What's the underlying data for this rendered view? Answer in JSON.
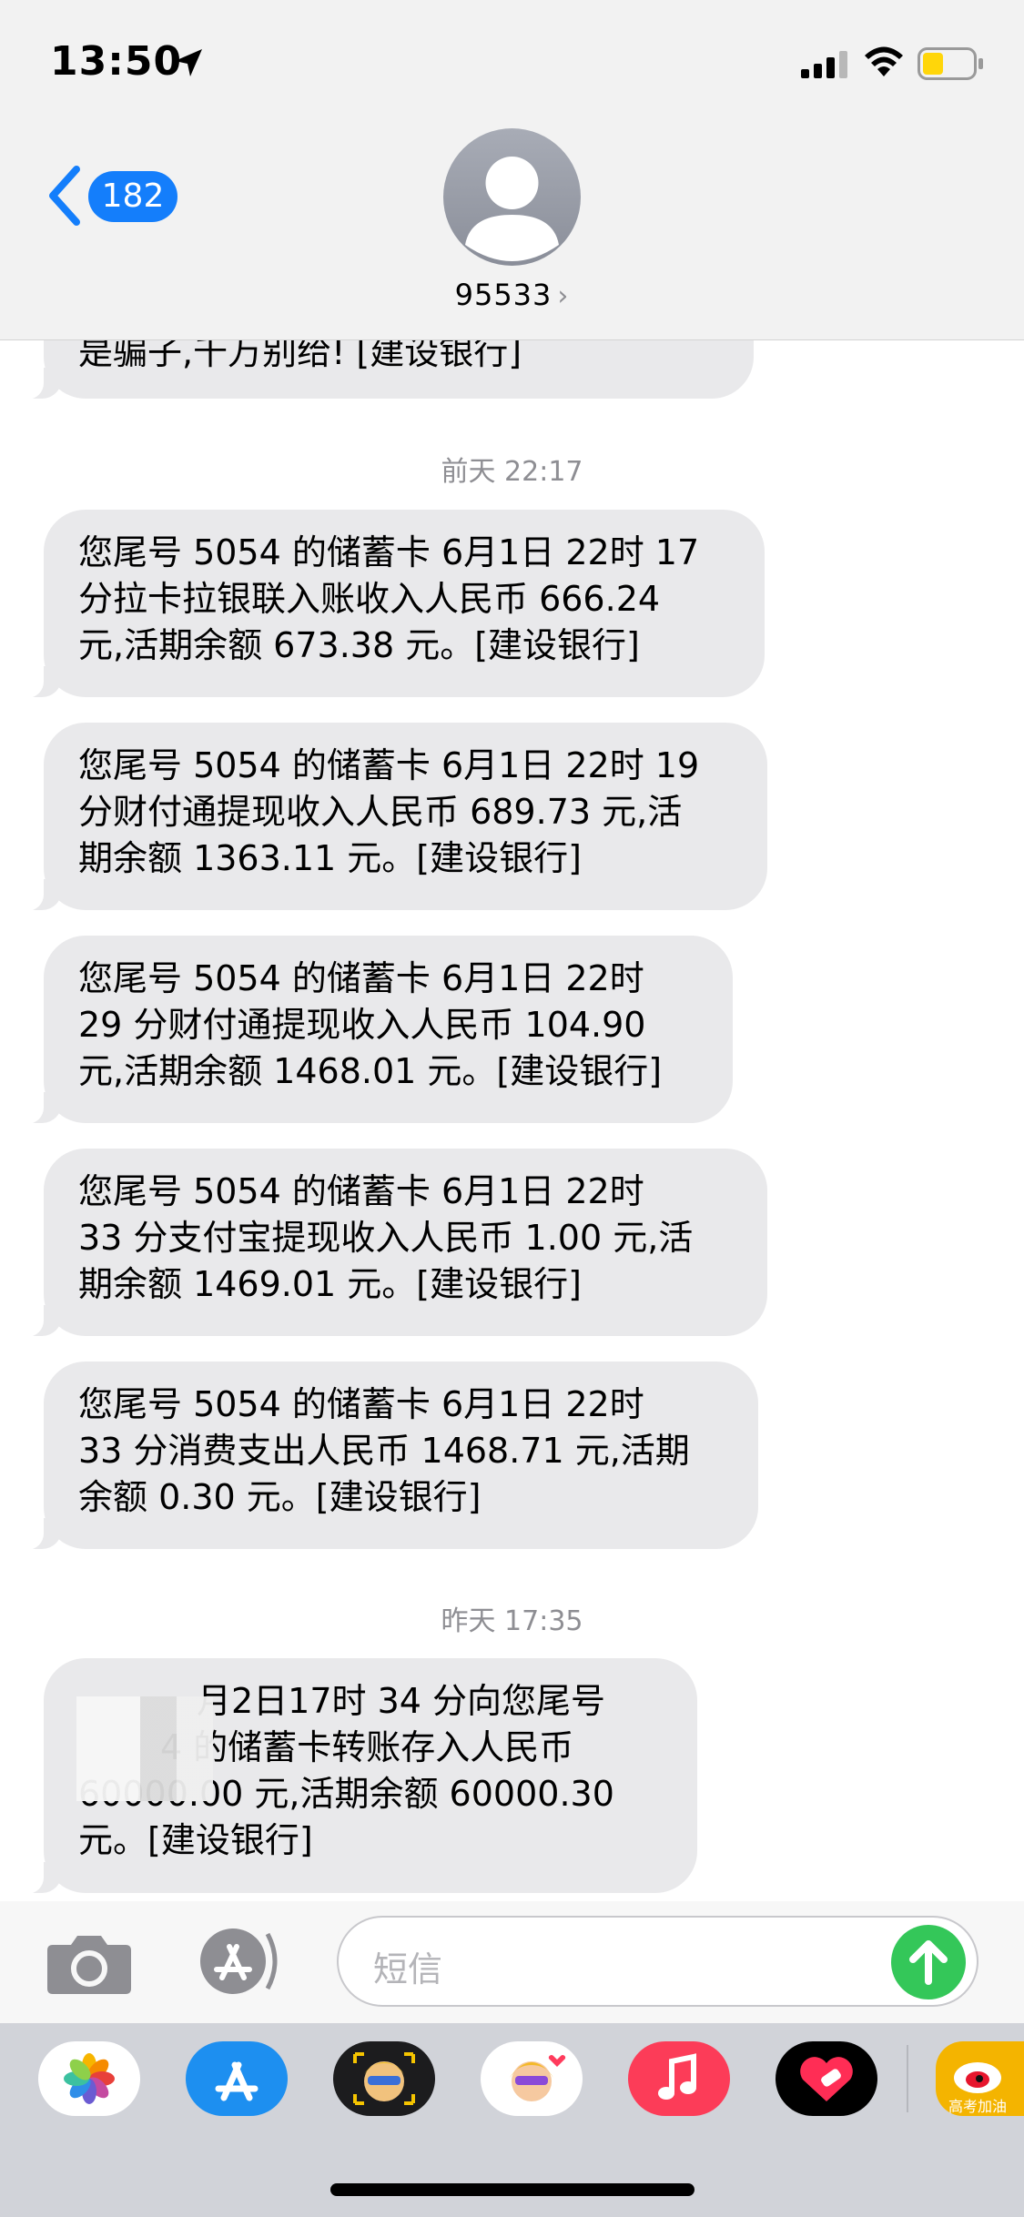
{
  "status": {
    "time": "13:50"
  },
  "nav": {
    "back_count": "182",
    "contact": "95533",
    "chevron": "›"
  },
  "partial_message": "是骗子,千万别给! [建设银行]",
  "timestamps": [
    "前天 22:17",
    "昨天 17:35"
  ],
  "messages": [
    [
      "您尾号 5054 的储蓄卡 6月1日 22时 17",
      "分拉卡拉银联入账收入人民币 666.24",
      "元,活期余额 673.38 元。[建设银行]"
    ],
    [
      "您尾号 5054 的储蓄卡 6月1日 22时 19",
      "分财付通提现收入人民币 689.73 元,活",
      "期余额 1363.11 元。[建设银行]"
    ],
    [
      "您尾号 5054 的储蓄卡 6月1日 22时",
      "29 分财付通提现收入人民币 104.90",
      "元,活期余额 1468.01 元。[建设银行]"
    ],
    [
      "您尾号 5054 的储蓄卡 6月1日 22时",
      "33 分支付宝提现收入人民币 1.00 元,活",
      "期余额 1469.01 元。[建设银行]"
    ],
    [
      "您尾号 5054 的储蓄卡 6月1日 22时",
      "33 分消费支出人民币 1468.71 元,活期",
      "余额 0.30 元。[建设银行]"
    ],
    [
      "月2日17时 34 分向您尾号",
      "4 的储蓄卡转账存入人民币",
      "60000.00 元,活期余额 60000.30",
      "元。[建设银行]"
    ]
  ],
  "input": {
    "placeholder": "短信"
  },
  "weibo_label": "高考加油",
  "colors": {
    "imessage_blue": "#147efb",
    "bubble_gray": "#e9e9eb",
    "send_green": "#34c759",
    "battery_yellow": "#ffd60a"
  },
  "icons": [
    "location-arrow-icon",
    "signal-icon",
    "wifi-icon",
    "battery-icon",
    "back-chevron-icon",
    "person-icon",
    "camera-icon",
    "app-store-icon",
    "send-arrow-icon",
    "photos-icon",
    "animoji-icon",
    "memoji-icon",
    "music-icon",
    "digital-touch-icon",
    "weibo-icon"
  ]
}
